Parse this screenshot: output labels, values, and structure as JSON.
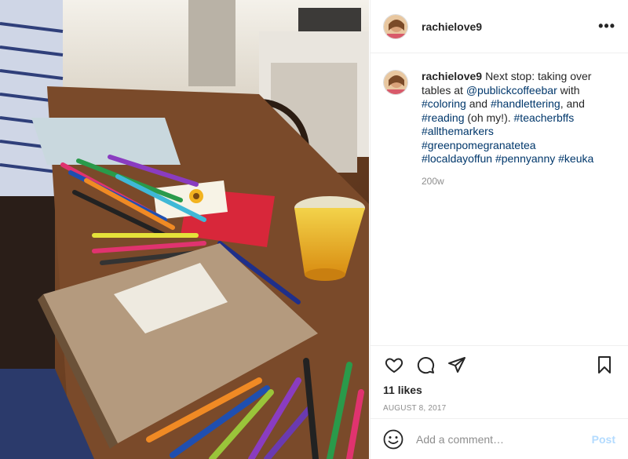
{
  "post": {
    "username": "rachielove9",
    "more_label": "•••",
    "caption": {
      "username": "rachielove9",
      "segments": [
        {
          "text": "Next stop: taking over tables at ",
          "link": false
        },
        {
          "text": "@publickcoffeebar",
          "link": true
        },
        {
          "text": " with ",
          "link": false
        },
        {
          "text": "#coloring",
          "link": true
        },
        {
          "text": " and ",
          "link": false
        },
        {
          "text": "#handlettering",
          "link": true
        },
        {
          "text": ", and ",
          "link": false
        },
        {
          "text": "#reading",
          "link": true
        },
        {
          "text": " (oh my!). ",
          "link": false
        },
        {
          "text": "#teacherbffs",
          "link": true
        },
        {
          "text": " ",
          "link": false
        },
        {
          "text": "#allthemarkers",
          "link": true
        },
        {
          "text": " ",
          "link": false
        },
        {
          "text": "#greenpomegranatetea",
          "link": true
        },
        {
          "text": " ",
          "link": false
        },
        {
          "text": "#localdayoffun",
          "link": true
        },
        {
          "text": " ",
          "link": false
        },
        {
          "text": "#pennyanny",
          "link": true
        },
        {
          "text": " ",
          "link": false
        },
        {
          "text": "#keuka",
          "link": true
        }
      ],
      "time_ago": "200w"
    },
    "likes": "11 likes",
    "date": "August 8, 2017",
    "comment_placeholder": "Add a comment…",
    "post_button": "Post",
    "icons": {
      "like": "heart-icon",
      "comment": "comment-icon",
      "share": "share-icon",
      "save": "bookmark-icon",
      "emoji": "emoji-icon"
    },
    "colors": {
      "link": "#00376b",
      "post_disabled": "#b3dbff",
      "muted": "#8e8e8e"
    }
  }
}
